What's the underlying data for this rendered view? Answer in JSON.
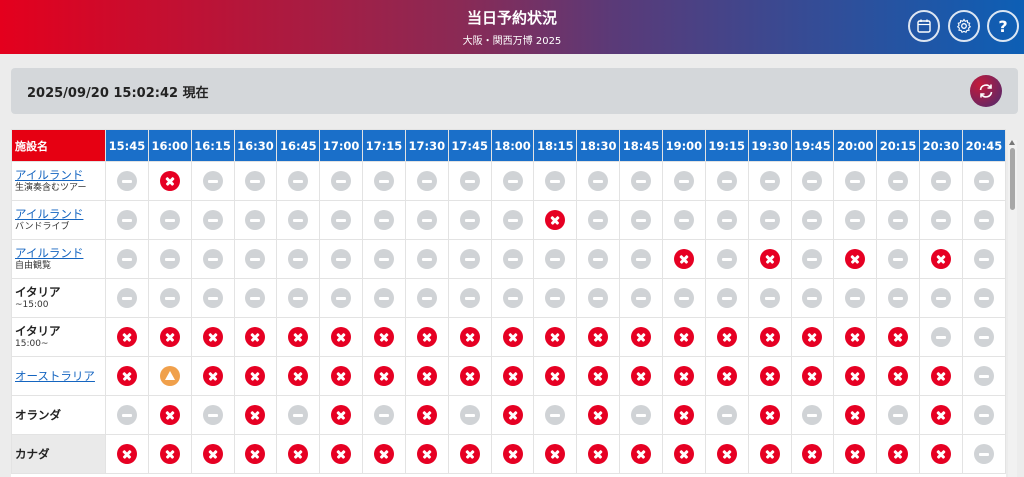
{
  "header": {
    "title": "当日予約状況",
    "subtitle": "大阪・関西万博 2025",
    "buttons": [
      "calendar-icon",
      "gear-icon",
      "help-icon"
    ],
    "help_label": "?"
  },
  "info": {
    "timestamp": "2025/09/20 15:02:42 現在",
    "refresh_icon": "refresh-icon"
  },
  "table": {
    "facility_header": "施設名",
    "times": [
      "15:45",
      "16:00",
      "16:15",
      "16:30",
      "16:45",
      "17:00",
      "17:15",
      "17:30",
      "17:45",
      "18:00",
      "18:15",
      "18:30",
      "18:45",
      "19:00",
      "19:15",
      "19:30",
      "19:45",
      "20:00",
      "20:15",
      "20:30",
      "20:45"
    ],
    "rows": [
      {
        "name": "アイルランド",
        "sub": "生演奏含むツアー",
        "link": true,
        "statuses": [
          "none",
          "full",
          "none",
          "none",
          "none",
          "none",
          "none",
          "none",
          "none",
          "none",
          "none",
          "none",
          "none",
          "none",
          "none",
          "none",
          "none",
          "none",
          "none",
          "none",
          "none"
        ]
      },
      {
        "name": "アイルランド",
        "sub": "バンドライブ",
        "link": true,
        "statuses": [
          "none",
          "none",
          "none",
          "none",
          "none",
          "none",
          "none",
          "none",
          "none",
          "none",
          "full",
          "none",
          "none",
          "none",
          "none",
          "none",
          "none",
          "none",
          "none",
          "none",
          "none"
        ]
      },
      {
        "name": "アイルランド",
        "sub": "自由観覧",
        "link": true,
        "statuses": [
          "none",
          "none",
          "none",
          "none",
          "none",
          "none",
          "none",
          "none",
          "none",
          "none",
          "none",
          "none",
          "none",
          "full",
          "none",
          "full",
          "none",
          "full",
          "none",
          "full",
          "none"
        ]
      },
      {
        "name": "イタリア",
        "sub": "~15:00",
        "link": false,
        "statuses": [
          "none",
          "none",
          "none",
          "none",
          "none",
          "none",
          "none",
          "none",
          "none",
          "none",
          "none",
          "none",
          "none",
          "none",
          "none",
          "none",
          "none",
          "none",
          "none",
          "none",
          "none"
        ]
      },
      {
        "name": "イタリア",
        "sub": "15:00~",
        "link": false,
        "statuses": [
          "full",
          "full",
          "full",
          "full",
          "full",
          "full",
          "full",
          "full",
          "full",
          "full",
          "full",
          "full",
          "full",
          "full",
          "full",
          "full",
          "full",
          "full",
          "full",
          "none",
          "none"
        ]
      },
      {
        "name": "オーストラリア",
        "sub": "",
        "link": true,
        "statuses": [
          "full",
          "few",
          "full",
          "full",
          "full",
          "full",
          "full",
          "full",
          "full",
          "full",
          "full",
          "full",
          "full",
          "full",
          "full",
          "full",
          "full",
          "full",
          "full",
          "full",
          "none"
        ]
      },
      {
        "name": "オランダ",
        "sub": "",
        "link": false,
        "statuses": [
          "none",
          "full",
          "none",
          "full",
          "none",
          "full",
          "none",
          "full",
          "none",
          "full",
          "none",
          "full",
          "none",
          "full",
          "none",
          "full",
          "none",
          "full",
          "none",
          "full",
          "none"
        ]
      },
      {
        "name": "カナダ",
        "sub": "",
        "link": false,
        "shaded": true,
        "statuses": [
          "full",
          "full",
          "full",
          "full",
          "full",
          "full",
          "full",
          "full",
          "full",
          "full",
          "full",
          "full",
          "full",
          "full",
          "full",
          "full",
          "full",
          "full",
          "full",
          "full",
          "none"
        ]
      }
    ]
  }
}
